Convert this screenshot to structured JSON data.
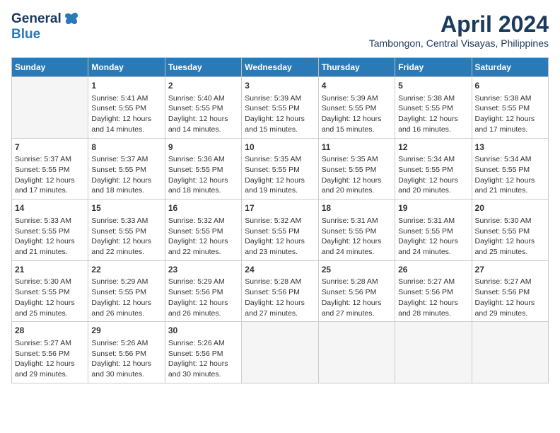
{
  "header": {
    "logo_general": "General",
    "logo_blue": "Blue",
    "title": "April 2024",
    "subtitle": "Tambongon, Central Visayas, Philippines"
  },
  "calendar": {
    "weekdays": [
      "Sunday",
      "Monday",
      "Tuesday",
      "Wednesday",
      "Thursday",
      "Friday",
      "Saturday"
    ],
    "weeks": [
      [
        {
          "day": "",
          "info": ""
        },
        {
          "day": "1",
          "info": "Sunrise: 5:41 AM\nSunset: 5:55 PM\nDaylight: 12 hours\nand 14 minutes."
        },
        {
          "day": "2",
          "info": "Sunrise: 5:40 AM\nSunset: 5:55 PM\nDaylight: 12 hours\nand 14 minutes."
        },
        {
          "day": "3",
          "info": "Sunrise: 5:39 AM\nSunset: 5:55 PM\nDaylight: 12 hours\nand 15 minutes."
        },
        {
          "day": "4",
          "info": "Sunrise: 5:39 AM\nSunset: 5:55 PM\nDaylight: 12 hours\nand 15 minutes."
        },
        {
          "day": "5",
          "info": "Sunrise: 5:38 AM\nSunset: 5:55 PM\nDaylight: 12 hours\nand 16 minutes."
        },
        {
          "day": "6",
          "info": "Sunrise: 5:38 AM\nSunset: 5:55 PM\nDaylight: 12 hours\nand 17 minutes."
        }
      ],
      [
        {
          "day": "7",
          "info": "Sunrise: 5:37 AM\nSunset: 5:55 PM\nDaylight: 12 hours\nand 17 minutes."
        },
        {
          "day": "8",
          "info": "Sunrise: 5:37 AM\nSunset: 5:55 PM\nDaylight: 12 hours\nand 18 minutes."
        },
        {
          "day": "9",
          "info": "Sunrise: 5:36 AM\nSunset: 5:55 PM\nDaylight: 12 hours\nand 18 minutes."
        },
        {
          "day": "10",
          "info": "Sunrise: 5:35 AM\nSunset: 5:55 PM\nDaylight: 12 hours\nand 19 minutes."
        },
        {
          "day": "11",
          "info": "Sunrise: 5:35 AM\nSunset: 5:55 PM\nDaylight: 12 hours\nand 20 minutes."
        },
        {
          "day": "12",
          "info": "Sunrise: 5:34 AM\nSunset: 5:55 PM\nDaylight: 12 hours\nand 20 minutes."
        },
        {
          "day": "13",
          "info": "Sunrise: 5:34 AM\nSunset: 5:55 PM\nDaylight: 12 hours\nand 21 minutes."
        }
      ],
      [
        {
          "day": "14",
          "info": "Sunrise: 5:33 AM\nSunset: 5:55 PM\nDaylight: 12 hours\nand 21 minutes."
        },
        {
          "day": "15",
          "info": "Sunrise: 5:33 AM\nSunset: 5:55 PM\nDaylight: 12 hours\nand 22 minutes."
        },
        {
          "day": "16",
          "info": "Sunrise: 5:32 AM\nSunset: 5:55 PM\nDaylight: 12 hours\nand 22 minutes."
        },
        {
          "day": "17",
          "info": "Sunrise: 5:32 AM\nSunset: 5:55 PM\nDaylight: 12 hours\nand 23 minutes."
        },
        {
          "day": "18",
          "info": "Sunrise: 5:31 AM\nSunset: 5:55 PM\nDaylight: 12 hours\nand 24 minutes."
        },
        {
          "day": "19",
          "info": "Sunrise: 5:31 AM\nSunset: 5:55 PM\nDaylight: 12 hours\nand 24 minutes."
        },
        {
          "day": "20",
          "info": "Sunrise: 5:30 AM\nSunset: 5:55 PM\nDaylight: 12 hours\nand 25 minutes."
        }
      ],
      [
        {
          "day": "21",
          "info": "Sunrise: 5:30 AM\nSunset: 5:55 PM\nDaylight: 12 hours\nand 25 minutes."
        },
        {
          "day": "22",
          "info": "Sunrise: 5:29 AM\nSunset: 5:55 PM\nDaylight: 12 hours\nand 26 minutes."
        },
        {
          "day": "23",
          "info": "Sunrise: 5:29 AM\nSunset: 5:56 PM\nDaylight: 12 hours\nand 26 minutes."
        },
        {
          "day": "24",
          "info": "Sunrise: 5:28 AM\nSunset: 5:56 PM\nDaylight: 12 hours\nand 27 minutes."
        },
        {
          "day": "25",
          "info": "Sunrise: 5:28 AM\nSunset: 5:56 PM\nDaylight: 12 hours\nand 27 minutes."
        },
        {
          "day": "26",
          "info": "Sunrise: 5:27 AM\nSunset: 5:56 PM\nDaylight: 12 hours\nand 28 minutes."
        },
        {
          "day": "27",
          "info": "Sunrise: 5:27 AM\nSunset: 5:56 PM\nDaylight: 12 hours\nand 29 minutes."
        }
      ],
      [
        {
          "day": "28",
          "info": "Sunrise: 5:27 AM\nSunset: 5:56 PM\nDaylight: 12 hours\nand 29 minutes."
        },
        {
          "day": "29",
          "info": "Sunrise: 5:26 AM\nSunset: 5:56 PM\nDaylight: 12 hours\nand 30 minutes."
        },
        {
          "day": "30",
          "info": "Sunrise: 5:26 AM\nSunset: 5:56 PM\nDaylight: 12 hours\nand 30 minutes."
        },
        {
          "day": "",
          "info": ""
        },
        {
          "day": "",
          "info": ""
        },
        {
          "day": "",
          "info": ""
        },
        {
          "day": "",
          "info": ""
        }
      ]
    ]
  }
}
